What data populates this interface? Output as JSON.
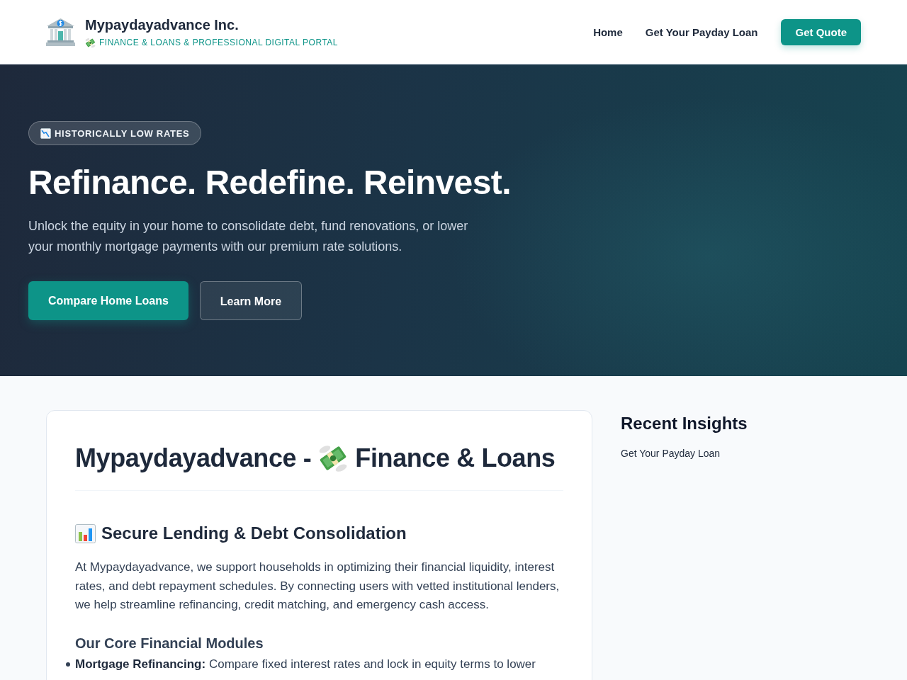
{
  "header": {
    "logo_title": "Mypaydayadvance Inc.",
    "tagline": "FINANCE & LOANS & PROFESSIONAL DIGITAL PORTAL",
    "nav": [
      {
        "label": "Home"
      },
      {
        "label": "Get Your Payday Loan"
      }
    ],
    "cta": "Get Quote"
  },
  "hero": {
    "badge": "HISTORICALLY LOW RATES",
    "title": "Refinance. Redefine. Reinvest.",
    "text": "Unlock the equity in your home to consolidate debt, fund renovations, or lower your monthly mortgage payments with our premium rate solutions.",
    "buttons": [
      {
        "label": "Compare Home Loans",
        "kind": "primary"
      },
      {
        "label": "Learn More",
        "kind": "secondary"
      }
    ]
  },
  "article": {
    "title_parts": [
      "Mypaydayadvance -",
      "Finance & Loans"
    ],
    "section_title": "Secure Lending & Debt Consolidation",
    "paragraph": "At Mypaydayadvance, we support households in optimizing their financial liquidity, interest rates, and debt repayment schedules. By connecting users with vetted institutional lenders, we help streamline refinancing, credit matching, and emergency cash access.",
    "subheading": "Our Core Financial Modules",
    "list": [
      "**Mortgage Refinancing:** Compare fixed interest rates and lock in equity terms to lower"
    ]
  },
  "sidebar": {
    "title": "Recent Insights",
    "links": [
      "Get Your Payday Loan"
    ]
  }
}
